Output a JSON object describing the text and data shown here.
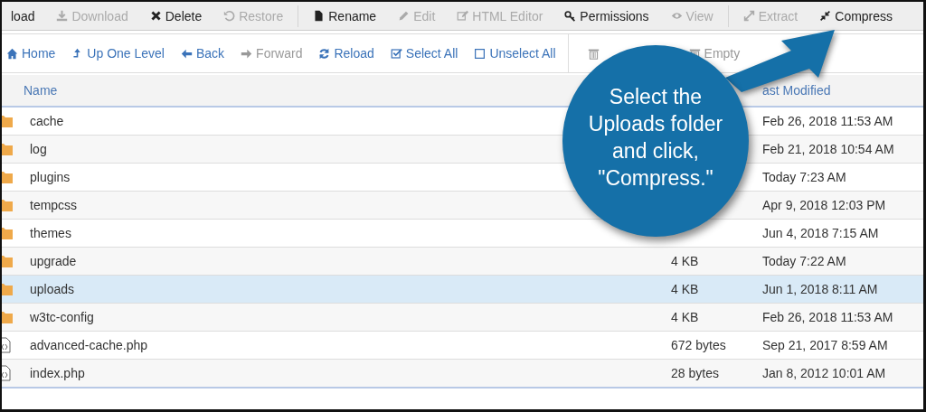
{
  "toolbar": [
    {
      "label": "load",
      "disabled": false
    },
    {
      "label": "Download",
      "disabled": true
    },
    {
      "label": "Delete",
      "disabled": false
    },
    {
      "label": "Restore",
      "disabled": true
    },
    {
      "label": "Rename",
      "disabled": false,
      "group_start": true
    },
    {
      "label": "Edit",
      "disabled": true
    },
    {
      "label": "HTML Editor",
      "disabled": true
    },
    {
      "label": "Permissions",
      "disabled": false
    },
    {
      "label": "View",
      "disabled": true
    },
    {
      "label": "Extract",
      "disabled": true,
      "group_start": true
    },
    {
      "label": "Compress",
      "disabled": false
    }
  ],
  "navbar": [
    {
      "label": "Home",
      "disabled": false
    },
    {
      "label": "Up One Level",
      "disabled": false
    },
    {
      "label": "Back",
      "disabled": false
    },
    {
      "label": "Forward",
      "disabled": true
    },
    {
      "label": "Reload",
      "disabled": false
    },
    {
      "label": "Select All",
      "disabled": false
    },
    {
      "label": "Unselect All",
      "disabled": false
    },
    {
      "disabled": true,
      "group_start": true
    },
    {
      "label": "Empty",
      "disabled": true
    }
  ],
  "table": {
    "columns": [
      "Name",
      "ast Modified"
    ],
    "rows": [
      {
        "kind": "folder",
        "name": "cache",
        "modified": "Feb 26, 2018 11:53 AM",
        "selected": false
      },
      {
        "kind": "folder",
        "name": "log",
        "modified": "Feb 21, 2018 10:54 AM",
        "selected": false
      },
      {
        "kind": "folder",
        "name": "plugins",
        "modified": "Today 7:23 AM",
        "selected": false
      },
      {
        "kind": "folder",
        "name": "tempcss",
        "modified": "Apr 9, 2018 12:03 PM",
        "selected": false
      },
      {
        "kind": "folder",
        "name": "themes",
        "modified": "Jun 4, 2018 7:15 AM",
        "selected": false
      },
      {
        "kind": "folder",
        "name": "upgrade",
        "size": "4 KB",
        "modified": "Today 7:22 AM",
        "selected": false
      },
      {
        "kind": "folder",
        "name": "uploads",
        "size": "4 KB",
        "modified": "Jun 1, 2018 8:11 AM",
        "selected": true
      },
      {
        "kind": "folder",
        "name": "w3tc-config",
        "size": "4 KB",
        "modified": "Feb 26, 2018 11:53 AM",
        "selected": false
      },
      {
        "kind": "file",
        "name": "advanced-cache.php",
        "size": "672 bytes",
        "modified": "Sep 21, 2017 8:59 AM",
        "selected": false
      },
      {
        "kind": "file",
        "name": "index.php",
        "size": "28 bytes",
        "modified": "Jan 8, 2012 10:01 AM",
        "selected": false
      }
    ]
  },
  "callout": {
    "lines": [
      "Select the",
      "Uploads folder",
      "and click,",
      "\"Compress.\""
    ]
  }
}
